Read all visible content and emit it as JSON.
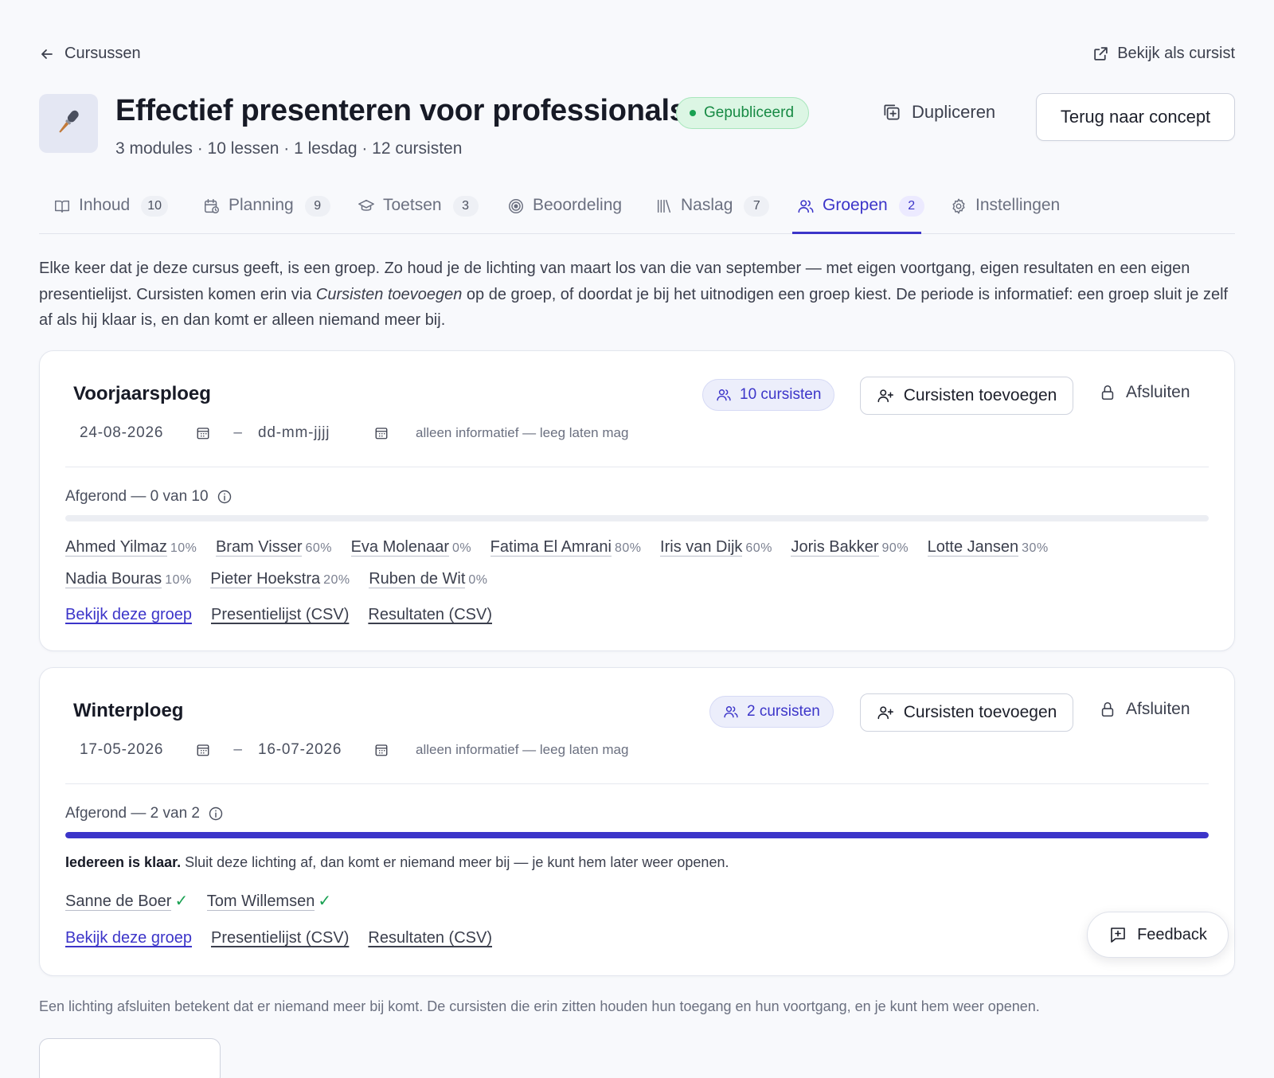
{
  "nav": {
    "back_label": "Cursussen",
    "view_as_label": "Bekijk als cursist"
  },
  "course": {
    "title": "Effectief presenteren voor professionals",
    "status": "Gepubliceerd",
    "meta": "3 modules · 10 lessen · 1 lesdag · 12 cursisten",
    "duplicate_label": "Dupliceren",
    "concept_label": "Terug naar concept"
  },
  "tabs": [
    {
      "label": "Inhoud",
      "count": "10",
      "icon": "book-icon",
      "active": false
    },
    {
      "label": "Planning",
      "count": "9",
      "icon": "calendar-icon",
      "active": false
    },
    {
      "label": "Toetsen",
      "count": "3",
      "icon": "graduation-cap-icon",
      "active": false
    },
    {
      "label": "Beoordeling",
      "count": "",
      "icon": "target-icon",
      "active": false
    },
    {
      "label": "Naslag",
      "count": "7",
      "icon": "library-icon",
      "active": false
    },
    {
      "label": "Groepen",
      "count": "2",
      "icon": "users-icon",
      "active": true
    },
    {
      "label": "Instellingen",
      "count": "",
      "icon": "gear-icon",
      "active": false
    }
  ],
  "intro": {
    "part1": "Elke keer dat je deze cursus geeft, is een groep. Zo houd je de lichting van maart los van die van september — met eigen voortgang, eigen resultaten en een eigen presentielijst. Cursisten komen erin via ",
    "emphasis": "Cursisten toevoegen",
    "part2": " op de groep, of doordat je bij het uitnodigen een groep kiest. De periode is informatief: een groep sluit je zelf af als hij klaar is, en dan komt er alleen niemand meer bij."
  },
  "groups": [
    {
      "name": "Voorjaarsploeg",
      "count_label": "10 cursisten",
      "add_label": "Cursisten toevoegen",
      "close_label": "Afsluiten",
      "start_date": "24-08-2026",
      "date_separator": "–",
      "end_date": "dd-mm-jjjj",
      "date_hint": "alleen informatief — leeg laten mag",
      "done_label": "Afgerond — 0 van 10",
      "progress": 0,
      "students": [
        {
          "name": "Ahmed Yilmaz",
          "pct": "10%"
        },
        {
          "name": "Bram Visser",
          "pct": "60%"
        },
        {
          "name": "Eva Molenaar",
          "pct": "0%"
        },
        {
          "name": "Fatima El Amrani",
          "pct": "80%"
        },
        {
          "name": "Iris van Dijk",
          "pct": "60%"
        },
        {
          "name": "Joris Bakker",
          "pct": "90%"
        },
        {
          "name": "Lotte Jansen",
          "pct": "30%"
        },
        {
          "name": "Nadia Bouras",
          "pct": "10%"
        },
        {
          "name": "Pieter Hoekstra",
          "pct": "20%"
        },
        {
          "name": "Ruben de Wit",
          "pct": "0%"
        }
      ],
      "links": {
        "view": "Bekijk deze groep",
        "attendance": "Presentielijst (CSV)",
        "results": "Resultaten (CSV)"
      }
    },
    {
      "name": "Winterploeg",
      "count_label": "2 cursisten",
      "add_label": "Cursisten toevoegen",
      "close_label": "Afsluiten",
      "start_date": "17-05-2026",
      "date_separator": "–",
      "end_date": "16-07-2026",
      "date_hint": "alleen informatief — leeg laten mag",
      "done_label": "Afgerond — 2 van 2",
      "progress": 1,
      "ready_bold": "Iedereen is klaar.",
      "ready_text": " Sluit deze lichting af, dan komt er niemand meer bij — je kunt hem later weer openen.",
      "students": [
        {
          "name": "Sanne de Boer",
          "check": "✓"
        },
        {
          "name": "Tom Willemsen",
          "check": "✓"
        }
      ],
      "links": {
        "view": "Bekijk deze groep",
        "attendance": "Presentielijst (CSV)",
        "results": "Resultaten (CSV)"
      }
    }
  ],
  "footer_note": "Een lichting afsluiten betekent dat er niemand meer bij komt. De cursisten die erin zitten houden hun toegang en hun voortgang, en je kunt hem weer openen.",
  "feedback_label": "Feedback",
  "colors": {
    "accent": "#3c35c9",
    "success": "#19a152",
    "background": "#f8f9fc"
  }
}
